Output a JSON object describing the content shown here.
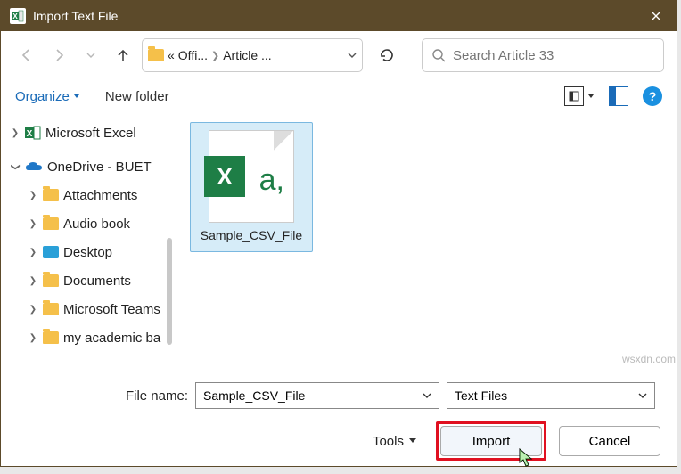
{
  "title": "Import Text File",
  "breadcrumb": {
    "seg1": "Offi...",
    "seg2": "Article ..."
  },
  "search": {
    "placeholder": "Search Article 33"
  },
  "toolbar": {
    "organize": "Organize",
    "newfolder": "New folder"
  },
  "tree": {
    "excel": "Microsoft Excel",
    "onedrive": "OneDrive - BUET",
    "children": [
      "Attachments",
      "Audio book",
      "Desktop",
      "Documents",
      "Microsoft Teams",
      "my academic ba"
    ]
  },
  "file": {
    "name": "Sample_CSV_File"
  },
  "footer": {
    "filename_label": "File name:",
    "filename_value": "Sample_CSV_File",
    "filter": "Text Files",
    "tools": "Tools",
    "import": "Import",
    "cancel": "Cancel"
  },
  "watermark": "wsxdn.com"
}
